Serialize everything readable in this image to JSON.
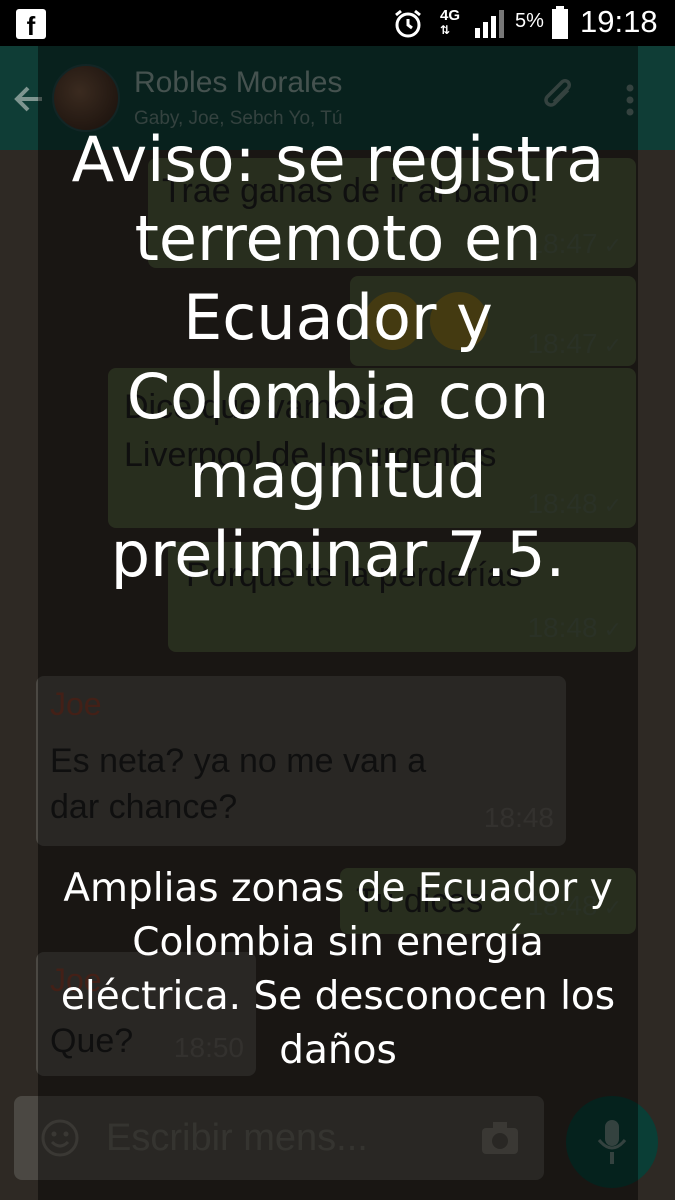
{
  "status_bar": {
    "app_icon": "facebook-icon",
    "alarm_icon": "alarm-clock-icon",
    "network": "4G",
    "battery_percent": "5%",
    "time": "19:18"
  },
  "chat": {
    "back_icon": "back-arrow-icon",
    "title": "Robles Morales",
    "members": "Gaby, Joe, Sebch Yo, Tú",
    "attach_icon": "paperclip-icon",
    "more_icon": "more-vertical-icon",
    "messages": [
      {
        "direction": "out",
        "text": "Trae ganas de ir al baño!",
        "time": "18:47"
      },
      {
        "direction": "out",
        "text": "",
        "emoji": "grimacing-face grimacing-face",
        "time": "18:47"
      },
      {
        "direction": "out",
        "text_line1": "Dice que vamos a",
        "text_line2": "Liverpool de Insurgentes",
        "time": "18:48"
      },
      {
        "direction": "out",
        "text": "Porque te la perderías",
        "time": "18:48"
      },
      {
        "direction": "in",
        "sender": "Joe",
        "text_line1": "Es neta?  ya no me van a",
        "text_line2": "dar chance?",
        "time": "18:48"
      },
      {
        "direction": "out",
        "text": "Tu dices",
        "time": "18:48"
      },
      {
        "direction": "in",
        "sender": "Joe",
        "text": "Que?",
        "time": "18:50"
      }
    ],
    "input": {
      "placeholder": "Escribir mens...",
      "emoji_icon": "smiley-icon",
      "camera_icon": "camera-icon",
      "mic_icon": "microphone-icon"
    }
  },
  "overlay": {
    "headline": "Aviso: se registra terremoto en Ecuador y Colombia con magnitud preliminar 7.5.",
    "body": "Amplias zonas de Ecuador y Colombia sin energía eléctrica. Se desconocen los daños"
  },
  "colors": {
    "header": "#0f3d36",
    "outgoing_bubble": "#4a5438",
    "incoming_bubble": "#4b4843",
    "overlay_text": "#ffffff"
  }
}
